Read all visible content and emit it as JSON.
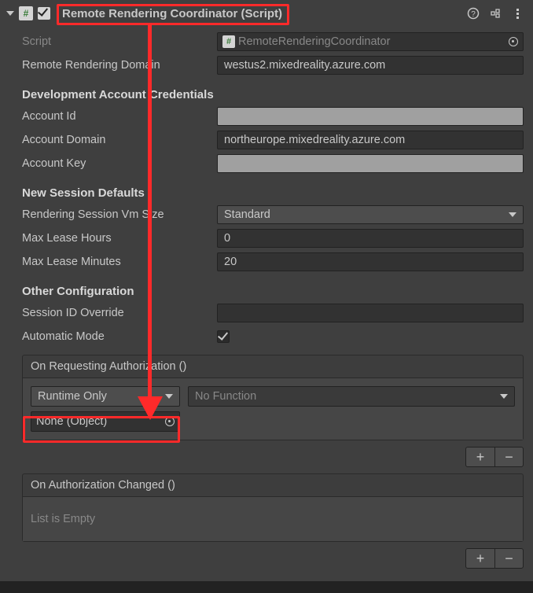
{
  "header": {
    "title": "Remote Rendering Coordinator (Script)",
    "enabled": true
  },
  "script": {
    "label": "Script",
    "value": "RemoteRenderingCoordinator"
  },
  "domain": {
    "label": "Remote Rendering Domain",
    "value": "westus2.mixedreality.azure.com"
  },
  "cred": {
    "heading": "Development Account Credentials",
    "id_label": "Account Id",
    "id_value": "",
    "domain_label": "Account Domain",
    "domain_value": "northeurope.mixedreality.azure.com",
    "key_label": "Account Key",
    "key_value": ""
  },
  "session": {
    "heading": "New Session Defaults",
    "vm_label": "Rendering Session Vm Size",
    "vm_value": "Standard",
    "hours_label": "Max Lease Hours",
    "hours_value": "0",
    "mins_label": "Max Lease Minutes",
    "mins_value": "20"
  },
  "other": {
    "heading": "Other Configuration",
    "sid_label": "Session ID Override",
    "sid_value": "",
    "auto_label": "Automatic Mode",
    "auto_checked": true
  },
  "evt1": {
    "title": "On Requesting Authorization ()",
    "mode": "Runtime Only",
    "target": "None (Object)",
    "func": "No Function"
  },
  "evt2": {
    "title": "On Authorization Changed ()",
    "empty": "List is Empty"
  },
  "scriptIcon": "#"
}
